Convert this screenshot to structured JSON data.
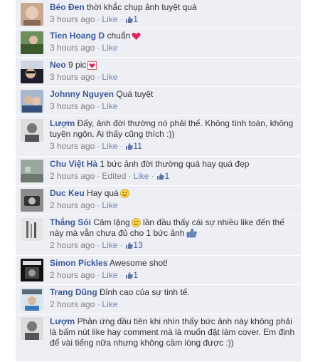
{
  "comments": [
    {
      "name": "Béo Đen",
      "text": "thời khắc chụp ảnh tuyệt quá",
      "time": "3 hours ago",
      "like": "Like",
      "count": "1"
    },
    {
      "name": "Tien Hoang D",
      "text": "chuẩn",
      "time": "3 hours ago",
      "like": "Like"
    },
    {
      "name": "Neo",
      "text": "9 pic",
      "time": "3 hours ago",
      "like": "Like"
    },
    {
      "name": "Johnny Nguyen",
      "text": "Quá tuyệt",
      "time": "3 hours ago",
      "like": "Like"
    },
    {
      "name": "Lượm",
      "text": "Đấy, ảnh đời thường nó phải thế. Không tính toán, không tuyên ngôn. Ai thấy cũng thích :))",
      "time": "3 hours ago",
      "like": "Like",
      "count": "11"
    },
    {
      "name": "Chu Việt Hà",
      "text": "1 bức ảnh đời thường quá hay quá đẹp",
      "time": "2 hours ago",
      "edited": "Edited",
      "like": "Like",
      "count": "1"
    },
    {
      "name": "Duc Keu",
      "text": "Hay quá",
      "time": "2 hours ago",
      "like": "Like"
    },
    {
      "name": "Thắng Sói",
      "text_a": "Câm lặng",
      "text_b": "lần đầu thấy cái sự nhiều like đến thế này mà vẫn chưa đủ cho 1 bức ảnh",
      "time": "2 hours ago",
      "like": "Like",
      "count": "13"
    },
    {
      "name": "Simon Pickles",
      "text": "Awesome shot!",
      "time": "2 hours ago",
      "like": "Like",
      "count": "1"
    },
    {
      "name": "Trang Dũng",
      "text": "Đỉnh cao của sự tinh tế.",
      "time": "2 hours ago",
      "like": "Like"
    },
    {
      "name": "Lượm",
      "text": "Phản ứng đầu tiên khi nhìn thấy bức ảnh này không phải là bấm nút like hay comment mà là muốn đặt làm cover. Em định để vài tiếng nữa nhưng không cầm lòng được :))"
    }
  ],
  "dot": "·",
  "colors": {
    "panel": "#edeff4",
    "name": "#3b5998",
    "meta_link": "#6d84b4",
    "heart": "#e0245e"
  },
  "icons": [
    "thumbs-up-icon",
    "heart-icon",
    "smiley-icon"
  ]
}
